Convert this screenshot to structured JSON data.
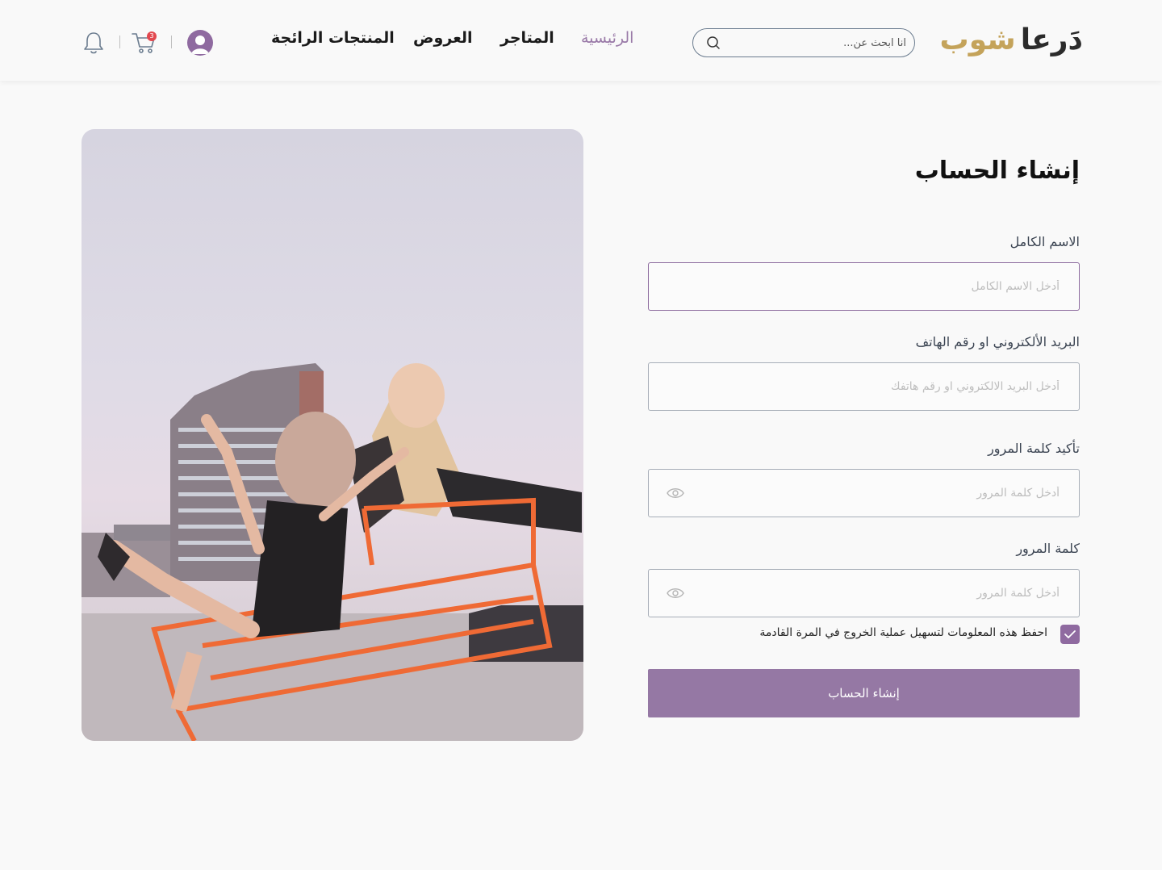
{
  "header": {
    "logo_part1": "دَرعا",
    "logo_part2": "شوب",
    "search_placeholder": "انا ابحث عن...",
    "nav": {
      "home": "الرئيسية",
      "stores": "المتاجر",
      "offers": "العروض",
      "featured": "المنتجات الرائجة"
    },
    "cart_count": "3",
    "accent_color": "#9a7aa8",
    "logo_gold": "#c4a35a"
  },
  "form": {
    "title": "إنشاء الحساب",
    "fields": [
      {
        "label": "الاسم الكامل",
        "placeholder": "أدخل الاسم الكامل"
      },
      {
        "label": "البريد الألكتروني او رقم الهاتف",
        "placeholder": "أدخل البريد الالكتروني او رقم هاتفك"
      },
      {
        "label": "تأكيد كلمة المرور",
        "placeholder": "أدخل كلمة المرور"
      },
      {
        "label": "كلمة المرور",
        "placeholder": "أدخل كلمة المرور"
      }
    ],
    "remember_label": "احفظ هذه المعلومات لتسهيل عملية الخروج في المرة القادمة",
    "remember_checked": true,
    "submit_label": "إنشاء الحساب",
    "button_color": "#9578a4"
  },
  "icons": {
    "search": "search-icon",
    "cart": "cart-icon",
    "bell": "bell-icon",
    "avatar": "user-avatar-icon",
    "eye": "eye-icon",
    "check": "check-icon"
  }
}
